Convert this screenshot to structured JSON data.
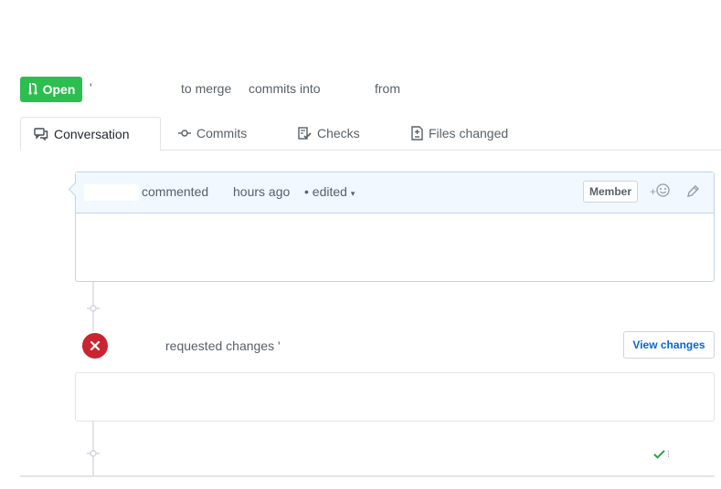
{
  "header": {
    "state": "Open",
    "tick": "'",
    "merge_prefix": "to merge",
    "commits_into": "commits into",
    "from": "from"
  },
  "tabs": [
    {
      "label": "Conversation",
      "icon": "comment-discussion-icon",
      "selected": true
    },
    {
      "label": "Commits",
      "icon": "git-commit-icon",
      "selected": false
    },
    {
      "label": "Checks",
      "icon": "checklist-icon",
      "selected": false
    },
    {
      "label": "Files changed",
      "icon": "diff-icon",
      "selected": false
    }
  ],
  "comment": {
    "action": "commented",
    "time": "hours ago",
    "edited": "• edited",
    "badge": "Member",
    "reaction_plus": "+"
  },
  "review": {
    "action": "requested changes",
    "tick": "'",
    "button": "View changes"
  },
  "colors": {
    "open_green": "#2cbe4e",
    "changes_red": "#cb2431",
    "link_blue": "#0366d6",
    "check_green": "#28a745"
  }
}
